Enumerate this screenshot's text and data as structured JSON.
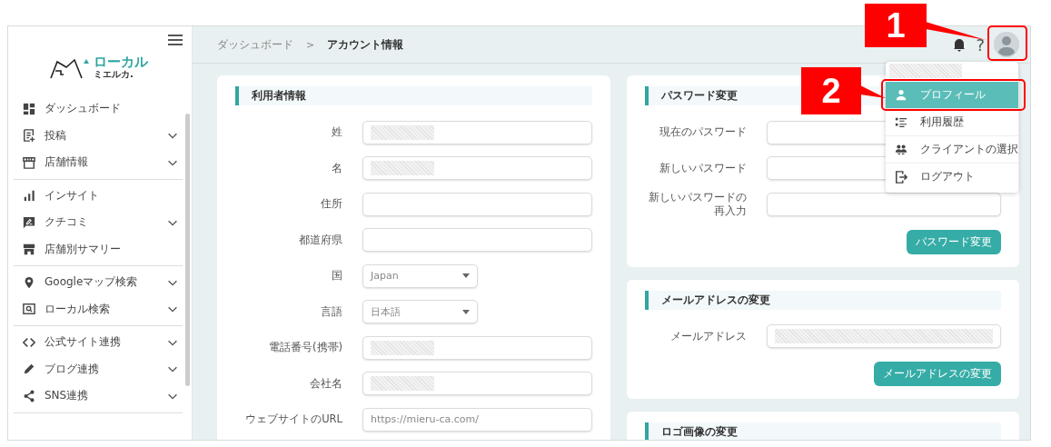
{
  "sidebar": {
    "logo": {
      "title": "ローカル",
      "subtitle": "ミエルカ."
    },
    "groups": [
      [
        {
          "label": "ダッシュボード",
          "has_submenu": false
        },
        {
          "label": "投稿",
          "has_submenu": true
        },
        {
          "label": "店舗情報",
          "has_submenu": true
        }
      ],
      [
        {
          "label": "インサイト",
          "has_submenu": false
        },
        {
          "label": "クチコミ",
          "has_submenu": true
        },
        {
          "label": "店舗別サマリー",
          "has_submenu": false
        }
      ],
      [
        {
          "label": "Googleマップ検索",
          "has_submenu": true
        },
        {
          "label": "ローカル検索",
          "has_submenu": true
        }
      ],
      [
        {
          "label": "公式サイト連携",
          "has_submenu": true
        },
        {
          "label": "ブログ連携",
          "has_submenu": true
        },
        {
          "label": "SNS連携",
          "has_submenu": true
        }
      ]
    ]
  },
  "breadcrumb": {
    "parent": "ダッシュボード",
    "separator": ">",
    "current": "アカウント情報"
  },
  "header": {
    "help": "?"
  },
  "user_card": {
    "title": "利用者情報",
    "fields": [
      {
        "label": "姓",
        "kind": "text",
        "redacted": true
      },
      {
        "label": "名",
        "kind": "text",
        "redacted": true
      },
      {
        "label": "住所",
        "kind": "text",
        "redacted": false
      },
      {
        "label": "都道府県",
        "kind": "text",
        "redacted": false
      },
      {
        "label": "国",
        "kind": "select",
        "value": "Japan"
      },
      {
        "label": "言語",
        "kind": "select",
        "value": "日本語"
      },
      {
        "label": "電話番号(携帯)",
        "kind": "text",
        "redacted": true
      },
      {
        "label": "会社名",
        "kind": "text",
        "redacted": true
      },
      {
        "label": "ウェブサイトのURL",
        "kind": "text",
        "placeholder": "https://mieru-ca.com/",
        "redacted": false
      }
    ]
  },
  "password_card": {
    "title": "パスワード変更",
    "fields": [
      {
        "label": "現在のパスワード",
        "kind": "text",
        "redacted": false
      },
      {
        "label": "新しいパスワード",
        "kind": "text",
        "redacted": false
      },
      {
        "label": "新しいパスワードの再入力",
        "kind": "text",
        "redacted": false
      }
    ],
    "button": "パスワード変更"
  },
  "email_card": {
    "title": "メールアドレスの変更",
    "fields": [
      {
        "label": "メールアドレス",
        "kind": "text",
        "redacted": true
      }
    ],
    "button": "メールアドレスの変更"
  },
  "logo_card": {
    "title": "ロゴ画像の変更"
  },
  "user_menu": {
    "header_redacted": true,
    "items": [
      {
        "label": "プロフィール",
        "selected": true
      },
      {
        "label": "利用履歴",
        "selected": false
      },
      {
        "label": "クライアントの選択",
        "selected": false
      },
      {
        "label": "ログアウト",
        "selected": false
      }
    ]
  },
  "callouts": [
    {
      "number": "1"
    },
    {
      "number": "2"
    }
  ]
}
